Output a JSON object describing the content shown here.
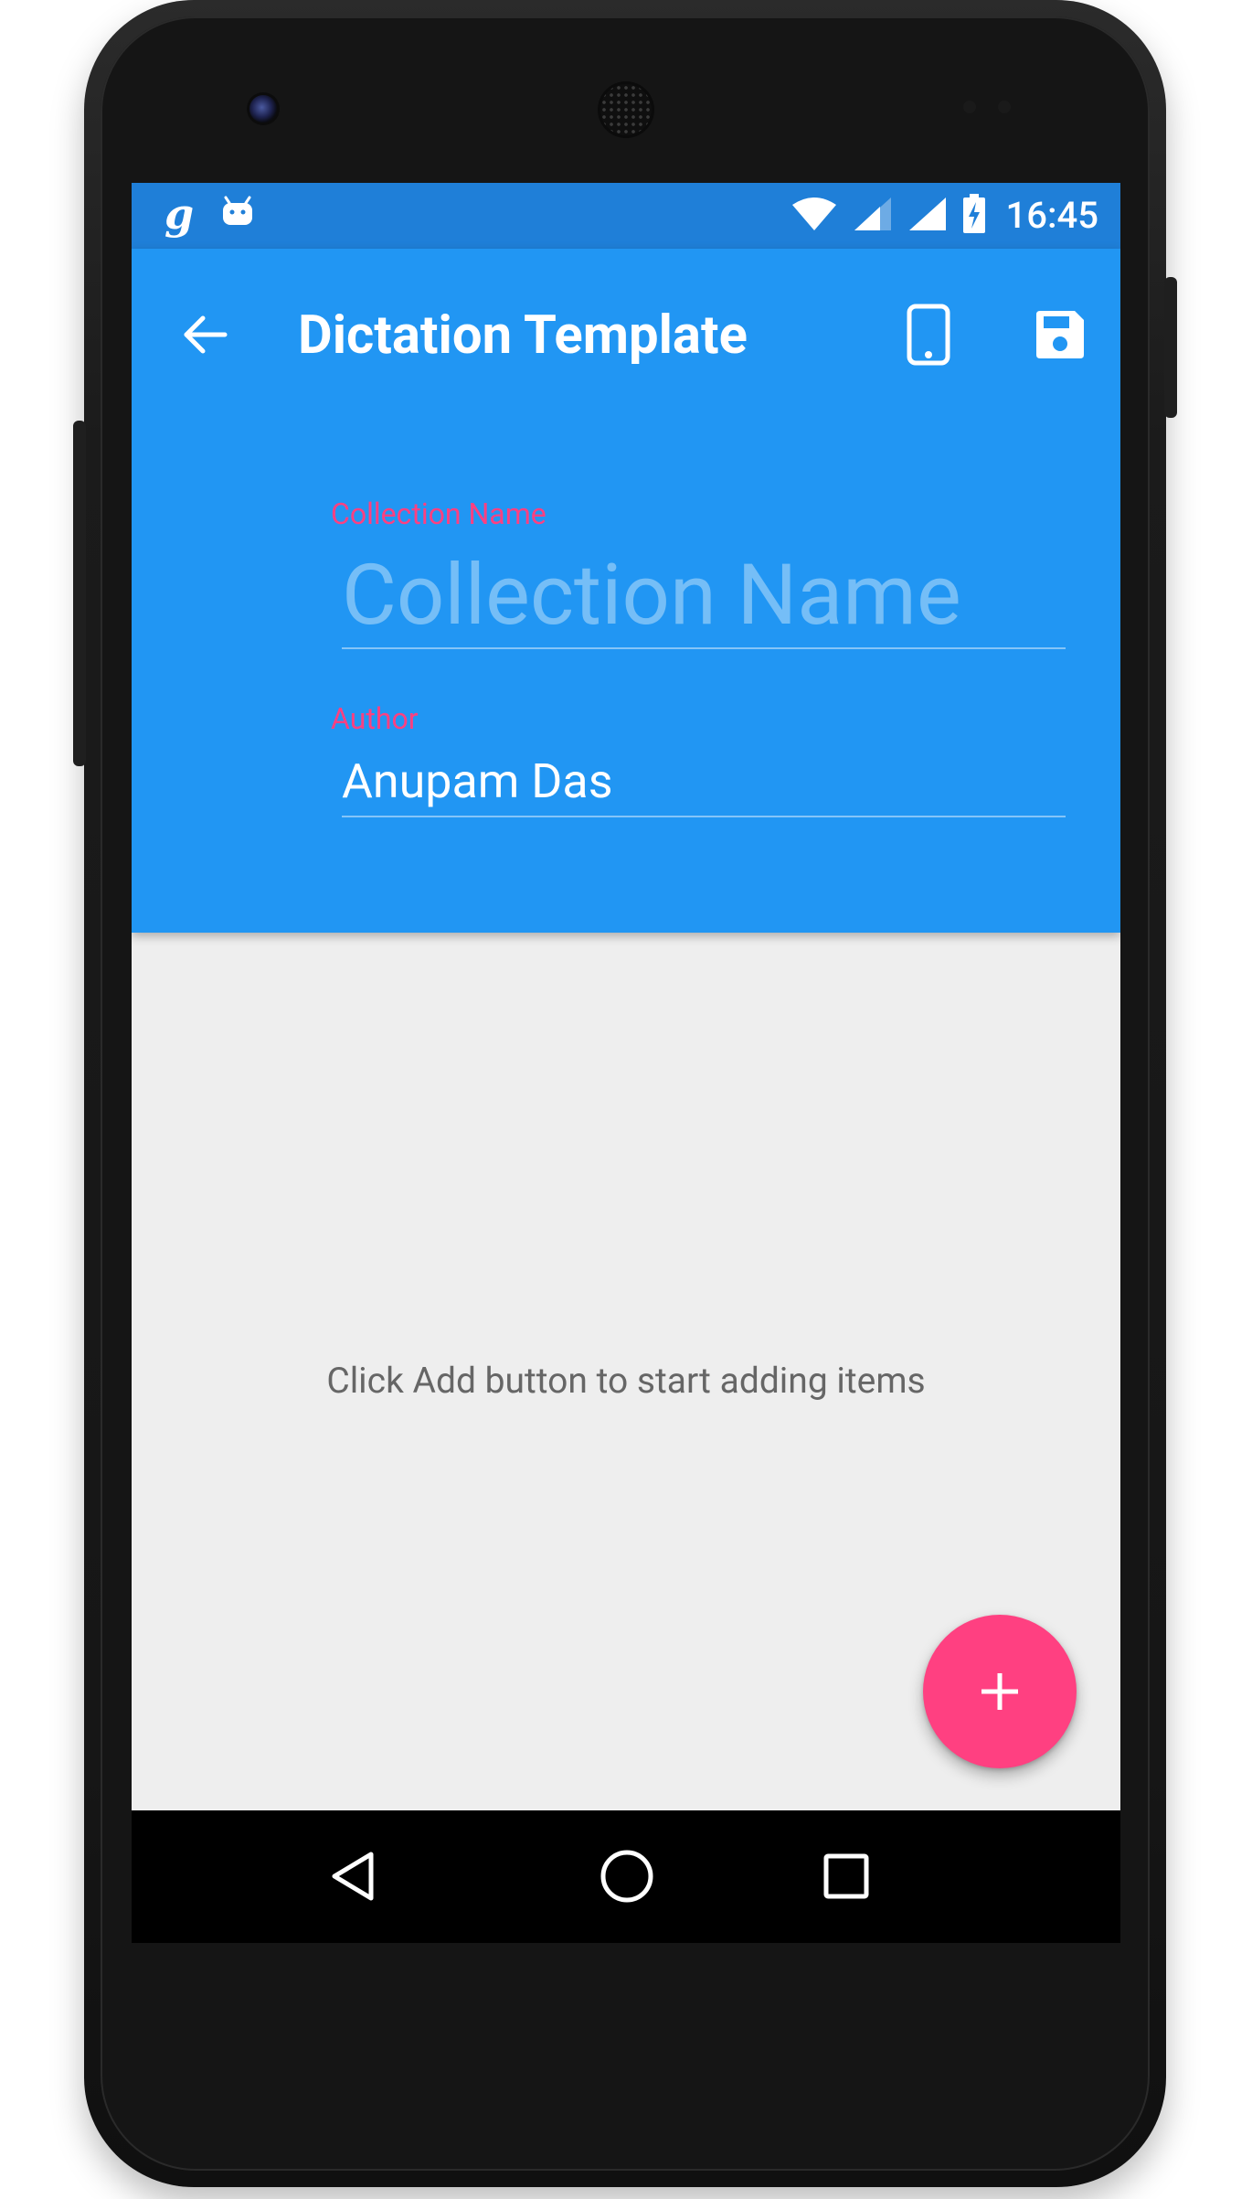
{
  "status_bar": {
    "time": "16:45",
    "left_icons": [
      "g-app-icon",
      "android-debug-icon"
    ],
    "right_icons": [
      "wifi-icon",
      "cell-signal-icon",
      "cell-signal-icon",
      "battery-charging-icon"
    ]
  },
  "toolbar": {
    "title": "Dictation Template",
    "back_icon": "arrow-left-icon",
    "actions": [
      {
        "icon": "smartphone-icon"
      },
      {
        "icon": "save-icon"
      }
    ]
  },
  "form": {
    "collection_name_label": "Collection Name",
    "collection_name_placeholder": "Collection Name",
    "collection_name_value": "",
    "author_label": "Author",
    "author_value": "Anupam Das"
  },
  "content": {
    "empty_message": "Click Add button to start adding items"
  },
  "fab": {
    "icon": "plus-icon"
  },
  "nav_bar": {
    "buttons": [
      "back-triangle-icon",
      "home-circle-icon",
      "recents-square-icon"
    ]
  },
  "colors": {
    "primary": "#2196f3",
    "primary_dark": "#1f7fd8",
    "accent": "#ff4081",
    "background": "#eeeeee",
    "nav": "#000000"
  }
}
